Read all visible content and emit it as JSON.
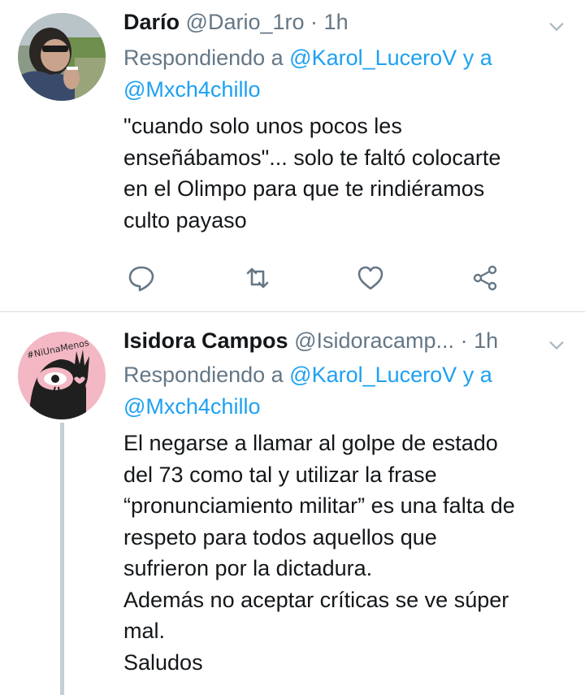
{
  "tweets": [
    {
      "name": "Darío",
      "handle": "@Dario_1ro",
      "separator": "·",
      "time": "1h",
      "replying_prefix": "Respondiendo a ",
      "reply_mention_1": "@Karol_LuceroV",
      "reply_join": " y a",
      "reply_mention_2": "@Mxch4chillo",
      "text": "\"cuando solo unos pocos les\nenseñábamos\"... solo te faltó colocarte\nen el Olimpo para que te rindiéramos\nculto payaso",
      "actions": [
        "reply-icon",
        "retweet-icon",
        "like-icon",
        "share-icon"
      ]
    },
    {
      "name": "Isidora Campos",
      "handle": "@Isidoracamp...",
      "separator": "·",
      "time": "1h",
      "replying_prefix": "Respondiendo a ",
      "reply_mention_1": "@Karol_LuceroV",
      "reply_join": " y a",
      "reply_mention_2": "@Mxch4chillo",
      "text": "El negarse a llamar al golpe de estado\ndel 73 como tal y utilizar la frase\n“pronunciamiento militar” es una falta de\nrespeto para todos aquellos que\nsufrieron por la dictadura.\nAdemás no aceptar críticas se ve súper\nmal.\nSaludos",
      "avatar_text": "#NiUnaMenos"
    }
  ],
  "colors": {
    "link": "#1da1f2",
    "muted": "#657786",
    "text": "#14171a",
    "divider": "#d9dde1",
    "thread_line": "#c5cfd6"
  }
}
